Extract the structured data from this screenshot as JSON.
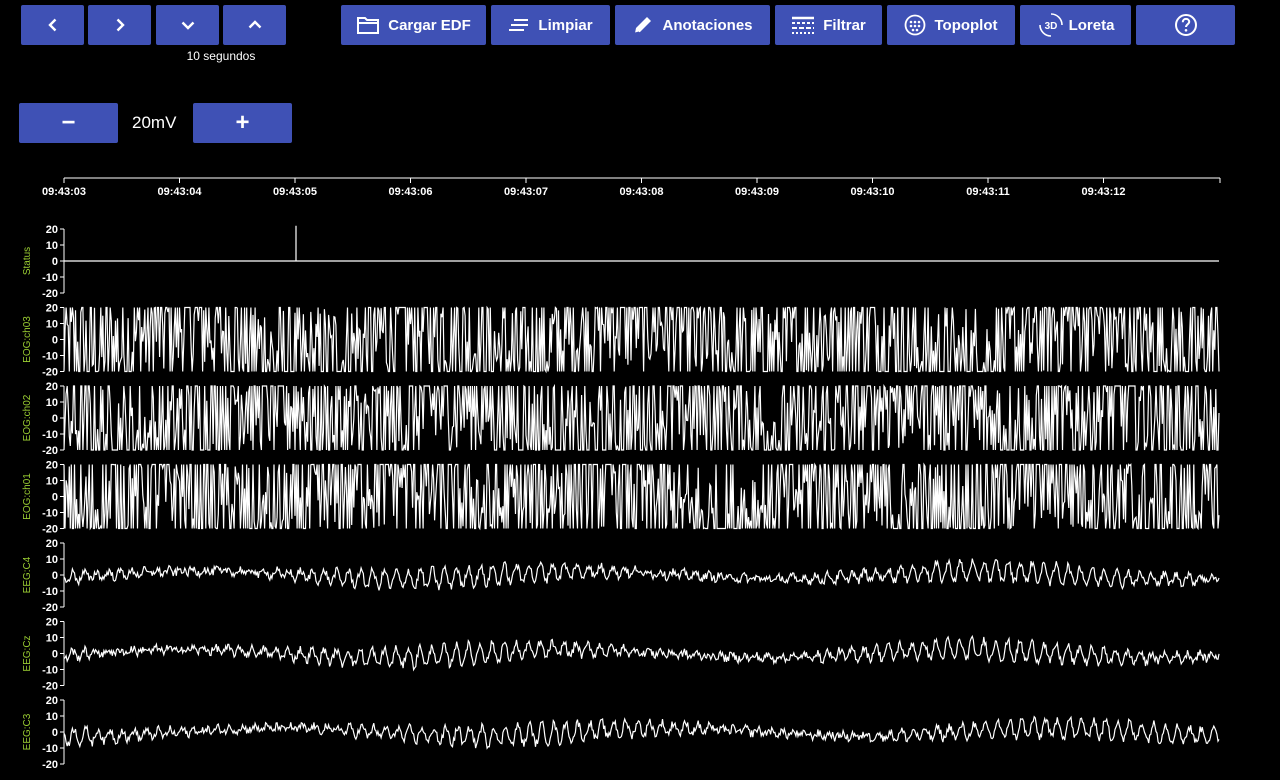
{
  "nav": {
    "prev_icon": "chevron-left-icon",
    "next_icon": "chevron-right-icon",
    "down_icon": "chevron-down-icon",
    "up_icon": "chevron-up-icon",
    "window_caption": "10 segundos"
  },
  "toolbar": {
    "load_label": "Cargar EDF",
    "clear_label": "Limpiar",
    "annotations_label": "Anotaciones",
    "filter_label": "Filtrar",
    "topoplot_label": "Topoplot",
    "loreta_label": "Loreta",
    "loreta_icon_text": "3D",
    "help_icon": "help-circle-icon"
  },
  "scale": {
    "minus_label": "−",
    "value": "20mV",
    "plus_label": "+"
  },
  "colors": {
    "button_bg": "#3f51b5",
    "channel_label": "#9acd32",
    "trace": "#ffffff",
    "background": "#000000"
  },
  "chart_data": {
    "type": "line",
    "time_ticks": [
      "09:43:03",
      "09:43:04",
      "09:43:05",
      "09:43:06",
      "09:43:07",
      "09:43:08",
      "09:43:09",
      "09:43:10",
      "09:43:11",
      "09:43:12"
    ],
    "y_ticks": [
      20,
      10,
      0,
      -10,
      -20
    ],
    "ylim": [
      -20,
      20
    ],
    "channels": [
      {
        "name": "Status",
        "kind": "status",
        "event_time": "09:43:05",
        "event_value": 22
      },
      {
        "name": "EOG:ch03",
        "kind": "saturated"
      },
      {
        "name": "EOG:ch02",
        "kind": "saturated"
      },
      {
        "name": "EOG:ch01",
        "kind": "saturated"
      },
      {
        "name": "EEG:C4",
        "kind": "eeg"
      },
      {
        "name": "EEG:Cz",
        "kind": "eeg"
      },
      {
        "name": "EEG:C3",
        "kind": "eeg"
      }
    ]
  }
}
